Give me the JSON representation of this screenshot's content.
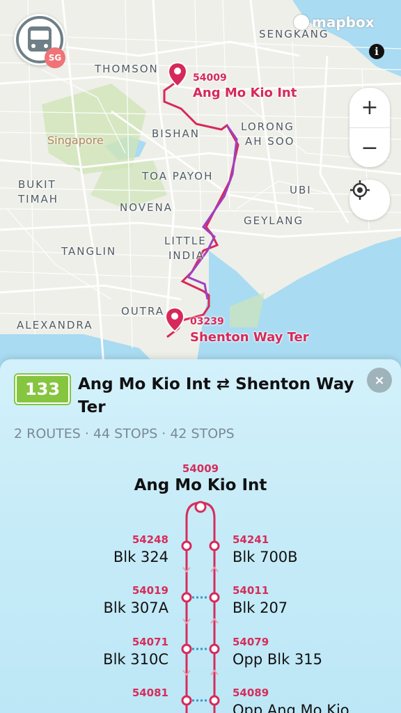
{
  "app": {
    "logo_badge": "SG",
    "mapbox_label": "mapbox",
    "info_label": "i",
    "zoom_in": "+",
    "zoom_out": "−"
  },
  "map": {
    "areas": [
      "SENGKANG",
      "THOMSON",
      "BISHAN",
      "LORONG",
      "AH SOO",
      "Singapore",
      "TOA PAYOH",
      "BUKIT",
      "TIMAH",
      "NOVENA",
      "UBI",
      "GEYLANG",
      "LITTLE",
      "INDIA",
      "TANGLIN",
      "OUTRA",
      "ALEXANDRA"
    ],
    "start_stop": {
      "code": "54009",
      "name": "Ang Mo Kio Int"
    },
    "end_stop": {
      "code": "03239",
      "name": "Shenton Way Ter"
    }
  },
  "service": {
    "number": "133",
    "title": "Ang Mo Kio Int ⇄ Shenton Way Ter",
    "meta": [
      "2 ROUTES",
      "44 STOPS",
      "42 STOPS"
    ],
    "close": "×"
  },
  "stops": {
    "start": {
      "code": "54009",
      "name": "Ang Mo Kio Int"
    },
    "left": [
      {
        "code": "54248",
        "name": "Blk 324"
      },
      {
        "code": "54019",
        "name": "Blk 307A"
      },
      {
        "code": "54071",
        "name": "Blk 310C"
      },
      {
        "code": "54081",
        "name": ""
      }
    ],
    "right": [
      {
        "code": "54241",
        "name": "Blk 700B"
      },
      {
        "code": "54011",
        "name": "Blk 207"
      },
      {
        "code": "54079",
        "name": "Opp Blk 315"
      },
      {
        "code": "54089",
        "name": "Opp Ang Mo Kio"
      }
    ]
  },
  "colors": {
    "route_line": "#d6295a",
    "route_alt": "#a040c0",
    "badge": "#86c540",
    "connector": "#3a93c8"
  }
}
